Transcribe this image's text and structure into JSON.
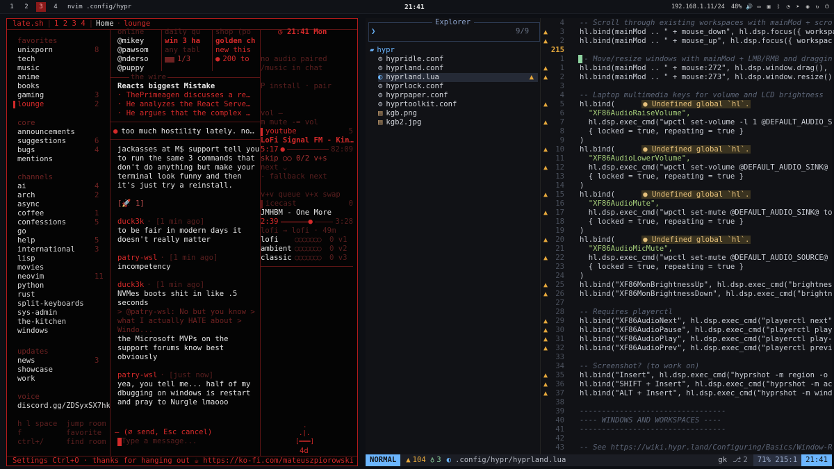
{
  "topbar": {
    "workspaces": [
      "1",
      "2",
      "3",
      "4"
    ],
    "active_workspace": "3",
    "title": "nvim .config/hypr",
    "clock": "21:41",
    "ip": "192.168.1.11/24",
    "battery": "48%"
  },
  "chat": {
    "app": "late.sh",
    "tabs": "1 2 3 4",
    "home": "Home",
    "room": "lounge",
    "sidebar": {
      "favorites_h": "favorites",
      "favorites": [
        [
          "unixporn",
          "8"
        ],
        [
          "tech",
          ""
        ],
        [
          "music",
          ""
        ],
        [
          "anime",
          ""
        ],
        [
          "books",
          ""
        ],
        [
          "gaming",
          "3"
        ],
        [
          "lounge",
          "2"
        ]
      ],
      "core_h": "core",
      "core": [
        [
          "announcements",
          ""
        ],
        [
          "suggestions",
          "6"
        ],
        [
          "bugs",
          "4"
        ],
        [
          "mentions",
          ""
        ]
      ],
      "channels_h": "channels",
      "channels": [
        [
          "ai",
          "4"
        ],
        [
          "arch",
          "2"
        ],
        [
          "async",
          ""
        ],
        [
          "coffee",
          "1"
        ],
        [
          "confessions",
          "5"
        ],
        [
          "go",
          ""
        ],
        [
          "help",
          "5"
        ],
        [
          "international",
          "3"
        ],
        [
          "lisp",
          ""
        ],
        [
          "movies",
          ""
        ],
        [
          "neovim",
          "11"
        ],
        [
          "python",
          ""
        ],
        [
          "rust",
          ""
        ],
        [
          "split-keyboards",
          ""
        ],
        [
          "sys-admin",
          ""
        ],
        [
          "the-kitchen",
          ""
        ],
        [
          "windows",
          ""
        ]
      ],
      "updates_h": "updates",
      "updates": [
        [
          "news",
          "3"
        ],
        [
          "showcase",
          ""
        ],
        [
          "work",
          ""
        ]
      ],
      "voice_h": "voice",
      "voice": "discord.gg/ZDSyxSX7hk",
      "help1": "h l space  jump room",
      "help2": "f          favorite",
      "help3": "ctrl+/     find room"
    },
    "online_h": "online",
    "online": [
      "@mikey",
      "@pawsom",
      "@nderso",
      "@puppy"
    ],
    "daily_h": "daily qu",
    "daily": [
      "win 3 ha",
      "any tabl",
      "1/3"
    ],
    "shop_h": "shop (po",
    "shop": [
      "golden ch",
      "new this",
      "200  to"
    ],
    "clock2": "21:41  Mon",
    "audio1": "no audio paired",
    "audio2": "/music in chat",
    "audio3": "P install · pair",
    "wire_h": "the wire",
    "wire_title": "Reacts biggest Mistake",
    "wire_items": [
      "· ThePrimeagen discusses a re…",
      "· He analyzes the React Serve…",
      "· He argues that the complex …"
    ],
    "banner": "too much hostility lately. no…",
    "vol_h": "vol  —",
    "vol1": "m mute  -= vol",
    "yt_h": "youtube",
    "yt_cnt": "5",
    "yt_track": "LoFi Signal FM - Kin…",
    "yt_time": "5:17",
    "yt_end": "82:09",
    "skip": "skip ○○ 0/2 v+s",
    "next": "next ⌄",
    "fallback": "- fallback next",
    "queue": "v+v queue  v+x swap",
    "icecast_h": "icecast",
    "icecast_cnt": "0",
    "ice_track": "JMHBM - One More",
    "ice_time": "2:39",
    "ice_end": "3:28",
    "lofi_route": "lofi → lofi · 49m",
    "genres": [
      [
        "lofi",
        "0 v1"
      ],
      [
        "ambient",
        "0 v2"
      ],
      [
        "classic",
        "0 v3"
      ]
    ],
    "messages": [
      {
        "nick": "",
        "ts": "",
        "text": "jackasses at M$ support tell you to run the same 3 commands that don't do anything but make your terminal look funny and then it's just try a reinstall.",
        "extra": "[🚀 1]"
      },
      {
        "nick": "duck3k",
        "ts": "· [1 min ago]",
        "text": "to be fair in modern days it doesn't really matter"
      },
      {
        "nick": "patry-wsl",
        "ts": "· [1 min ago]",
        "text": "incompetency"
      },
      {
        "nick": "duck3k",
        "ts": "· [1 min ago]",
        "text": "NVMes boots shit in like .5 seconds",
        "quote": "> @patry-wsl: No but you know > what I actually HATE about > Windo..."
      },
      {
        "nick": "",
        "ts": "",
        "text": "the Microsoft MVPs on the support forums know best obviously"
      },
      {
        "nick": "patry-wsl",
        "ts": "· [just now]",
        "text": "yea, you tell me... half of my dbugging on windows is restart and pray to Nurgle lmaooo"
      }
    ],
    "compose_h": "— (⌀ send, Esc cancel)",
    "compose": "Type a message...",
    "mascot_age": "4d",
    "footer": "Settings Ctrl+O · thanks for hanging out ☕ https://ko-fi.com/mateuszpiorowski"
  },
  "nvim": {
    "explorer_title": "Explorer",
    "explorer_count": "9/9",
    "folder": "hypr",
    "files": [
      "hypridle.conf",
      "hyprland.conf",
      "hyprland.lua",
      "hyprlock.conf",
      "hyprpaper.conf",
      "hyprtoolkit.conf",
      "kgb.png",
      "kgb2.jpg"
    ],
    "status_mode": "NORMAL",
    "status_warn": "104",
    "status_hint": "3",
    "status_path": ".config/hypr/hyprland.lua",
    "status_enc": "gk",
    "status_branch": "2",
    "status_pos": "71%  215:1",
    "status_clock": "21:41",
    "lines": [
      [
        "4",
        "-- Scroll through existing workspaces with mainMod + scro",
        "cm"
      ],
      [
        "3",
        "hl.bind(mainMod .. \" + mouse_down\", hl.dsp.focus({ workspa",
        ""
      ],
      [
        "2",
        "hl.bind(mainMod .. \" + mouse_up\", hl.dsp.focus({ workspac",
        ""
      ],
      [
        "215",
        "",
        ""
      ],
      [
        "1",
        "-- Move/resize windows with mainMod + LMB/RMB and draggin",
        "cm"
      ],
      [
        "1",
        "hl.bind(mainMod .. \" + mouse:272\", hl.dsp.window.drag(),",
        ""
      ],
      [
        "2",
        "hl.bind(mainMod .. \" + mouse:273\", hl.dsp.window.resize()",
        ""
      ],
      [
        "3",
        "",
        ""
      ],
      [
        "4",
        "-- Laptop multimedia keys for volume and LCD brightness",
        "cm"
      ],
      [
        "5",
        "hl.bind(      ● Undefined global `hl`.",
        "u"
      ],
      [
        "6",
        "  \"XF86AudioRaiseVolume\",",
        "s"
      ],
      [
        "7",
        "  hl.dsp.exec_cmd(\"wpctl set-volume -l 1 @DEFAULT_AUDIO_S",
        ""
      ],
      [
        "8",
        "  { locked = true, repeating = true }",
        ""
      ],
      [
        "9",
        ")",
        ""
      ],
      [
        "10",
        "hl.bind(      ● Undefined global `hl`.",
        "u"
      ],
      [
        "11",
        "  \"XF86AudioLowerVolume\",",
        "s"
      ],
      [
        "12",
        "  hl.dsp.exec_cmd(\"wpctl set-volume @DEFAULT_AUDIO_SINK@",
        ""
      ],
      [
        "13",
        "  { locked = true, repeating = true }",
        ""
      ],
      [
        "14",
        ")",
        ""
      ],
      [
        "15",
        "hl.bind(      ● Undefined global `hl`.",
        "u"
      ],
      [
        "16",
        "  \"XF86AudioMute\",",
        "s"
      ],
      [
        "17",
        "  hl.dsp.exec_cmd(\"wpctl set-mute @DEFAULT_AUDIO_SINK@ to",
        ""
      ],
      [
        "18",
        "  { locked = true, repeating = true }",
        ""
      ],
      [
        "19",
        ")",
        ""
      ],
      [
        "20",
        "hl.bind(      ● Undefined global `hl`.",
        "u"
      ],
      [
        "21",
        "  \"XF86AudioMicMute\",",
        "s"
      ],
      [
        "22",
        "  hl.dsp.exec_cmd(\"wpctl set-mute @DEFAULT_AUDIO_SOURCE@",
        ""
      ],
      [
        "23",
        "  { locked = true, repeating = true }",
        ""
      ],
      [
        "24",
        ")",
        ""
      ],
      [
        "25",
        "hl.bind(\"XF86MonBrightnessUp\", hl.dsp.exec_cmd(\"brightnes",
        ""
      ],
      [
        "26",
        "hl.bind(\"XF86MonBrightnessDown\", hl.dsp.exec_cmd(\"brightn",
        ""
      ],
      [
        "27",
        "",
        ""
      ],
      [
        "28",
        "-- Requires playerctl",
        "cm"
      ],
      [
        "29",
        "hl.bind(\"XF86AudioNext\", hl.dsp.exec_cmd(\"playerctl next\"",
        ""
      ],
      [
        "30",
        "hl.bind(\"XF86AudioPause\", hl.dsp.exec_cmd(\"playerctl play",
        ""
      ],
      [
        "31",
        "hl.bind(\"XF86AudioPlay\", hl.dsp.exec_cmd(\"playerctl play-",
        ""
      ],
      [
        "32",
        "hl.bind(\"XF86AudioPrev\", hl.dsp.exec_cmd(\"playerctl previ",
        ""
      ],
      [
        "33",
        "",
        ""
      ],
      [
        "34",
        "-- Screenshot? (to work on)",
        "cm"
      ],
      [
        "35",
        "hl.bind(\"Insert\", hl.dsp.exec_cmd(\"hyprshot -m region -o",
        ""
      ],
      [
        "36",
        "hl.bind(\"SHIFT + Insert\", hl.dsp.exec_cmd(\"hyprshot -m ac",
        ""
      ],
      [
        "37",
        "hl.bind(\"ALT + Insert\", hl.dsp.exec_cmd(\"hyprshot -m wind",
        ""
      ],
      [
        "38",
        "",
        ""
      ],
      [
        "39",
        "---------------------------------",
        "cm"
      ],
      [
        "40",
        "---- WINDOWS AND WORKSPACES ----",
        "cm"
      ],
      [
        "41",
        "---------------------------------",
        "cm"
      ],
      [
        "42",
        "",
        ""
      ],
      [
        "43",
        "-- See https://wiki.hypr.land/Configuring/Basics/Window-R",
        "cm"
      ]
    ]
  }
}
